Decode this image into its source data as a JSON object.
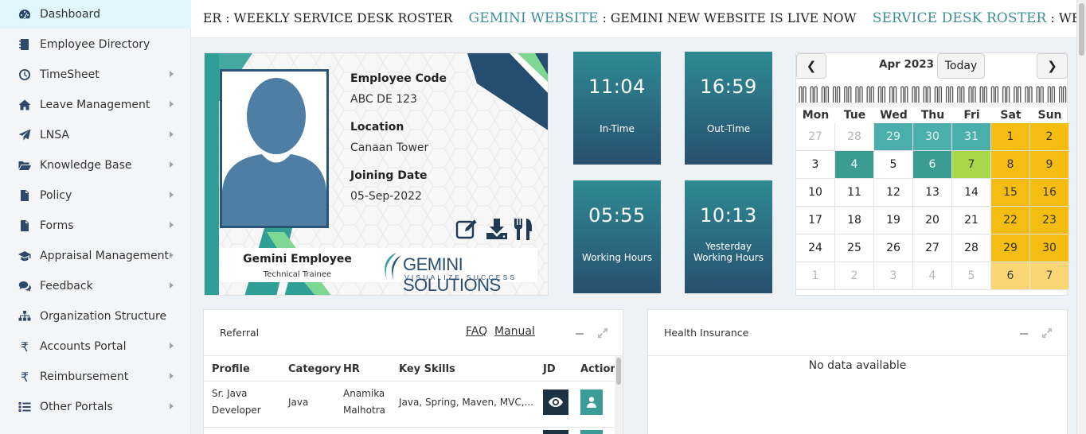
{
  "sidebar": {
    "items": [
      {
        "label": "Dashboard",
        "icon": "dashboard-icon",
        "has_submenu": false,
        "active": true
      },
      {
        "label": "Employee Directory",
        "icon": "address-book-icon",
        "has_submenu": false
      },
      {
        "label": "TimeSheet",
        "icon": "clock-icon",
        "has_submenu": true
      },
      {
        "label": "Leave Management",
        "icon": "home-icon",
        "has_submenu": true
      },
      {
        "label": "LNSA",
        "icon": "paper-plane-icon",
        "has_submenu": true
      },
      {
        "label": "Knowledge Base",
        "icon": "folder-open-icon",
        "has_submenu": true
      },
      {
        "label": "Policy",
        "icon": "file-icon",
        "has_submenu": true
      },
      {
        "label": "Forms",
        "icon": "file-text-icon",
        "has_submenu": true
      },
      {
        "label": "Appraisal Management",
        "icon": "graduation-cap-icon",
        "has_submenu": true
      },
      {
        "label": "Feedback",
        "icon": "comments-icon",
        "has_submenu": true
      },
      {
        "label": "Organization Structure",
        "icon": "sitemap-icon",
        "has_submenu": false
      },
      {
        "label": "Accounts Portal",
        "icon": "rupee-icon",
        "has_submenu": true
      },
      {
        "label": "Reimbursement",
        "icon": "rupee-icon",
        "has_submenu": true
      },
      {
        "label": "Other Portals",
        "icon": "list-icon",
        "has_submenu": true
      }
    ]
  },
  "ticker": {
    "lead_text": "ER : WEEKLY SERVICE DESK ROSTER",
    "items": [
      {
        "heading": "GEMINI WEBSITE",
        "text": ": GEMINI NEW WEBSITE IS LIVE NOW"
      },
      {
        "heading": "SERVICE DESK ROSTER",
        "text": ": WEEKLY SERVICE DE"
      }
    ]
  },
  "id_card": {
    "code_label": "Employee Code",
    "code_value": "ABC DE 123",
    "location_label": "Location",
    "location_value": "Canaan Tower",
    "joining_label": "Joining Date",
    "joining_value": "05-Sep-2022",
    "name": "Gemini Employee",
    "designation": "Technical Trainee",
    "logo_text": "GEMINI SOLUTIONS",
    "logo_tagline": "VISUALIZE SUCCESS"
  },
  "time_tiles": {
    "in_time": {
      "value": "11:04",
      "label": "In-Time"
    },
    "out_time": {
      "value": "16:59",
      "label": "Out-Time"
    },
    "working_hours": {
      "value": "05:55",
      "label": "Working Hours"
    },
    "yesterday_hours": {
      "value": "10:13",
      "label_line1": "Yesterday",
      "label_line2": "Working Hours"
    }
  },
  "calendar": {
    "title": "Apr 2023",
    "prev_label": "❮",
    "next_label": "❯",
    "today_label": "Today",
    "weekdays": [
      "Mon",
      "Tue",
      "Wed",
      "Thu",
      "Fri",
      "Sat",
      "Sun"
    ],
    "weeks": [
      [
        {
          "d": "27",
          "s": "other"
        },
        {
          "d": "28",
          "s": "other"
        },
        {
          "d": "29",
          "s": "teal other"
        },
        {
          "d": "30",
          "s": "teal other"
        },
        {
          "d": "31",
          "s": "teal other"
        },
        {
          "d": "1",
          "s": "wknd"
        },
        {
          "d": "2",
          "s": "wknd"
        }
      ],
      [
        {
          "d": "3",
          "s": ""
        },
        {
          "d": "4",
          "s": "teal dark"
        },
        {
          "d": "5",
          "s": ""
        },
        {
          "d": "6",
          "s": "teal dark"
        },
        {
          "d": "7",
          "s": "green"
        },
        {
          "d": "8",
          "s": "wknd"
        },
        {
          "d": "9",
          "s": "wknd"
        }
      ],
      [
        {
          "d": "10",
          "s": ""
        },
        {
          "d": "11",
          "s": ""
        },
        {
          "d": "12",
          "s": ""
        },
        {
          "d": "13",
          "s": ""
        },
        {
          "d": "14",
          "s": ""
        },
        {
          "d": "15",
          "s": "wknd"
        },
        {
          "d": "16",
          "s": "wknd"
        }
      ],
      [
        {
          "d": "17",
          "s": ""
        },
        {
          "d": "18",
          "s": ""
        },
        {
          "d": "19",
          "s": ""
        },
        {
          "d": "20",
          "s": ""
        },
        {
          "d": "21",
          "s": ""
        },
        {
          "d": "22",
          "s": "wknd"
        },
        {
          "d": "23",
          "s": "wknd"
        }
      ],
      [
        {
          "d": "24",
          "s": ""
        },
        {
          "d": "25",
          "s": ""
        },
        {
          "d": "26",
          "s": ""
        },
        {
          "d": "27",
          "s": ""
        },
        {
          "d": "28",
          "s": ""
        },
        {
          "d": "29",
          "s": "wknd"
        },
        {
          "d": "30",
          "s": "wknd"
        }
      ],
      [
        {
          "d": "1",
          "s": "other"
        },
        {
          "d": "2",
          "s": "other"
        },
        {
          "d": "3",
          "s": "other"
        },
        {
          "d": "4",
          "s": "other"
        },
        {
          "d": "5",
          "s": "other"
        },
        {
          "d": "6",
          "s": "wknd pale"
        },
        {
          "d": "7",
          "s": "wknd pale"
        }
      ]
    ]
  },
  "referral": {
    "title": "Referral",
    "faq_label": "FAQ",
    "manual_label": "Manual",
    "columns": [
      "Profile",
      "Category",
      "HR",
      "Key Skills",
      "JD",
      "Action"
    ],
    "rows": [
      {
        "profile_line1": "Sr. Java",
        "profile_line2": "Developer",
        "category": "Java",
        "hr_line1": "Anamika",
        "hr_line2": "Malhotra",
        "skills": "Java, Spring, Maven, MVC,..."
      }
    ]
  },
  "health": {
    "title": "Health Insurance",
    "empty_text": "No data available"
  },
  "colors": {
    "accent_teal": "#3a8f99",
    "tile_dark": "#28506e",
    "weekend": "#f5bc12",
    "present_green": "#a8d84a"
  }
}
